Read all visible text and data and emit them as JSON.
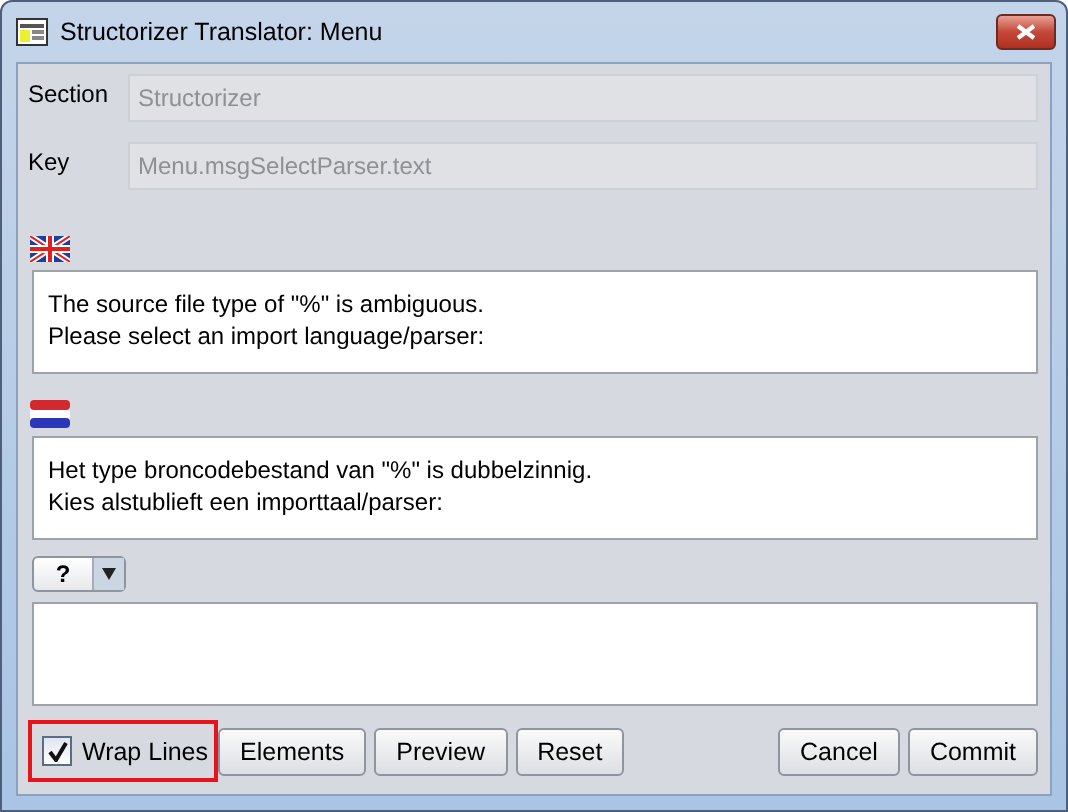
{
  "window": {
    "title": "Structorizer Translator: Menu"
  },
  "fields": [
    {
      "label": "Section",
      "value": "Structorizer"
    },
    {
      "label": "Key",
      "value": "Menu.msgSelectParser.text"
    }
  ],
  "translations": [
    {
      "kind": "uk",
      "lines": [
        "The source file type of \"%\" is ambiguous.",
        "Please select an import language/parser:"
      ]
    },
    {
      "kind": "nl",
      "lines": [
        "Het type broncodebestand van \"%\" is dubbelzinnig.",
        "Kies alstublieft een importtaal/parser:"
      ]
    }
  ],
  "target": {
    "language": "?"
  },
  "wrap_lines": {
    "label": "Wrap Lines",
    "checked": true,
    "highlighted": true
  },
  "buttons_left": [
    "Elements",
    "Preview",
    "Reset"
  ],
  "buttons_right": [
    "Cancel",
    "Commit"
  ]
}
